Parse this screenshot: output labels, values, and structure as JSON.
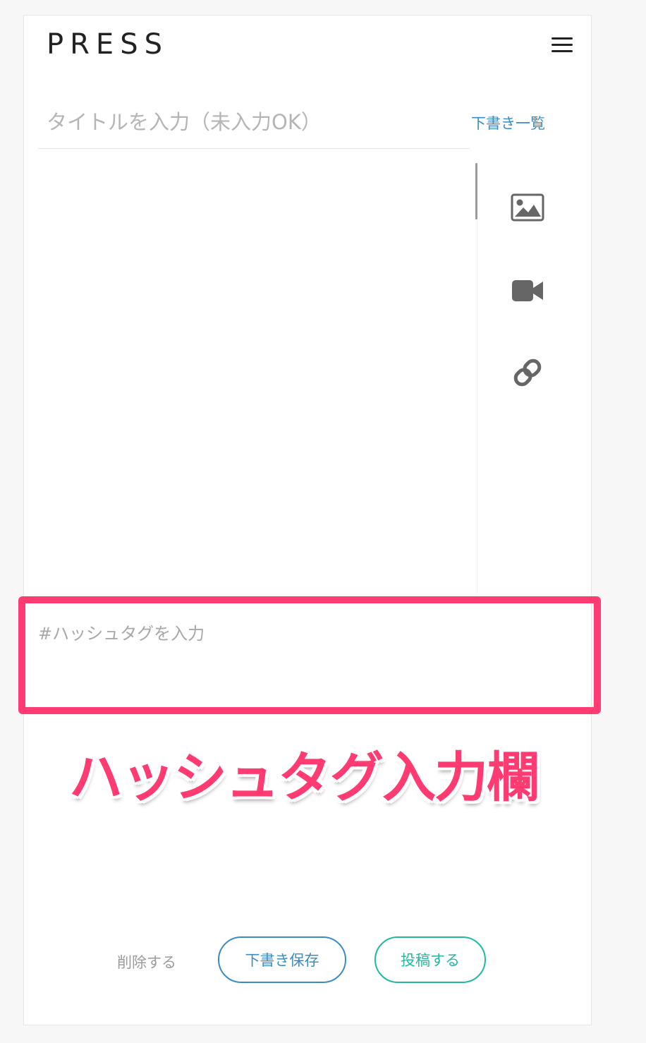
{
  "header": {
    "logo": "PRESS",
    "menu_icon": "hamburger-menu-icon"
  },
  "title_field": {
    "placeholder": "タイトルを入力（未入力OK）",
    "value": ""
  },
  "drafts_link": "下書き一覧",
  "editor": {
    "value": ""
  },
  "tools": [
    {
      "icon": "image-icon"
    },
    {
      "icon": "video-camera-icon"
    },
    {
      "icon": "link-icon"
    }
  ],
  "hashtag_field": {
    "placeholder": "#ハッシュタグを入力",
    "value": ""
  },
  "annotation": {
    "text": "ハッシュタグ入力欄",
    "color": "#ff3b72"
  },
  "actions": {
    "delete_label": "削除する",
    "save_draft_label": "下書き保存",
    "post_label": "投稿する"
  },
  "colors": {
    "link_blue": "#3a8dc4",
    "post_green": "#21b9a0",
    "highlight_pink": "#ff3b72"
  }
}
